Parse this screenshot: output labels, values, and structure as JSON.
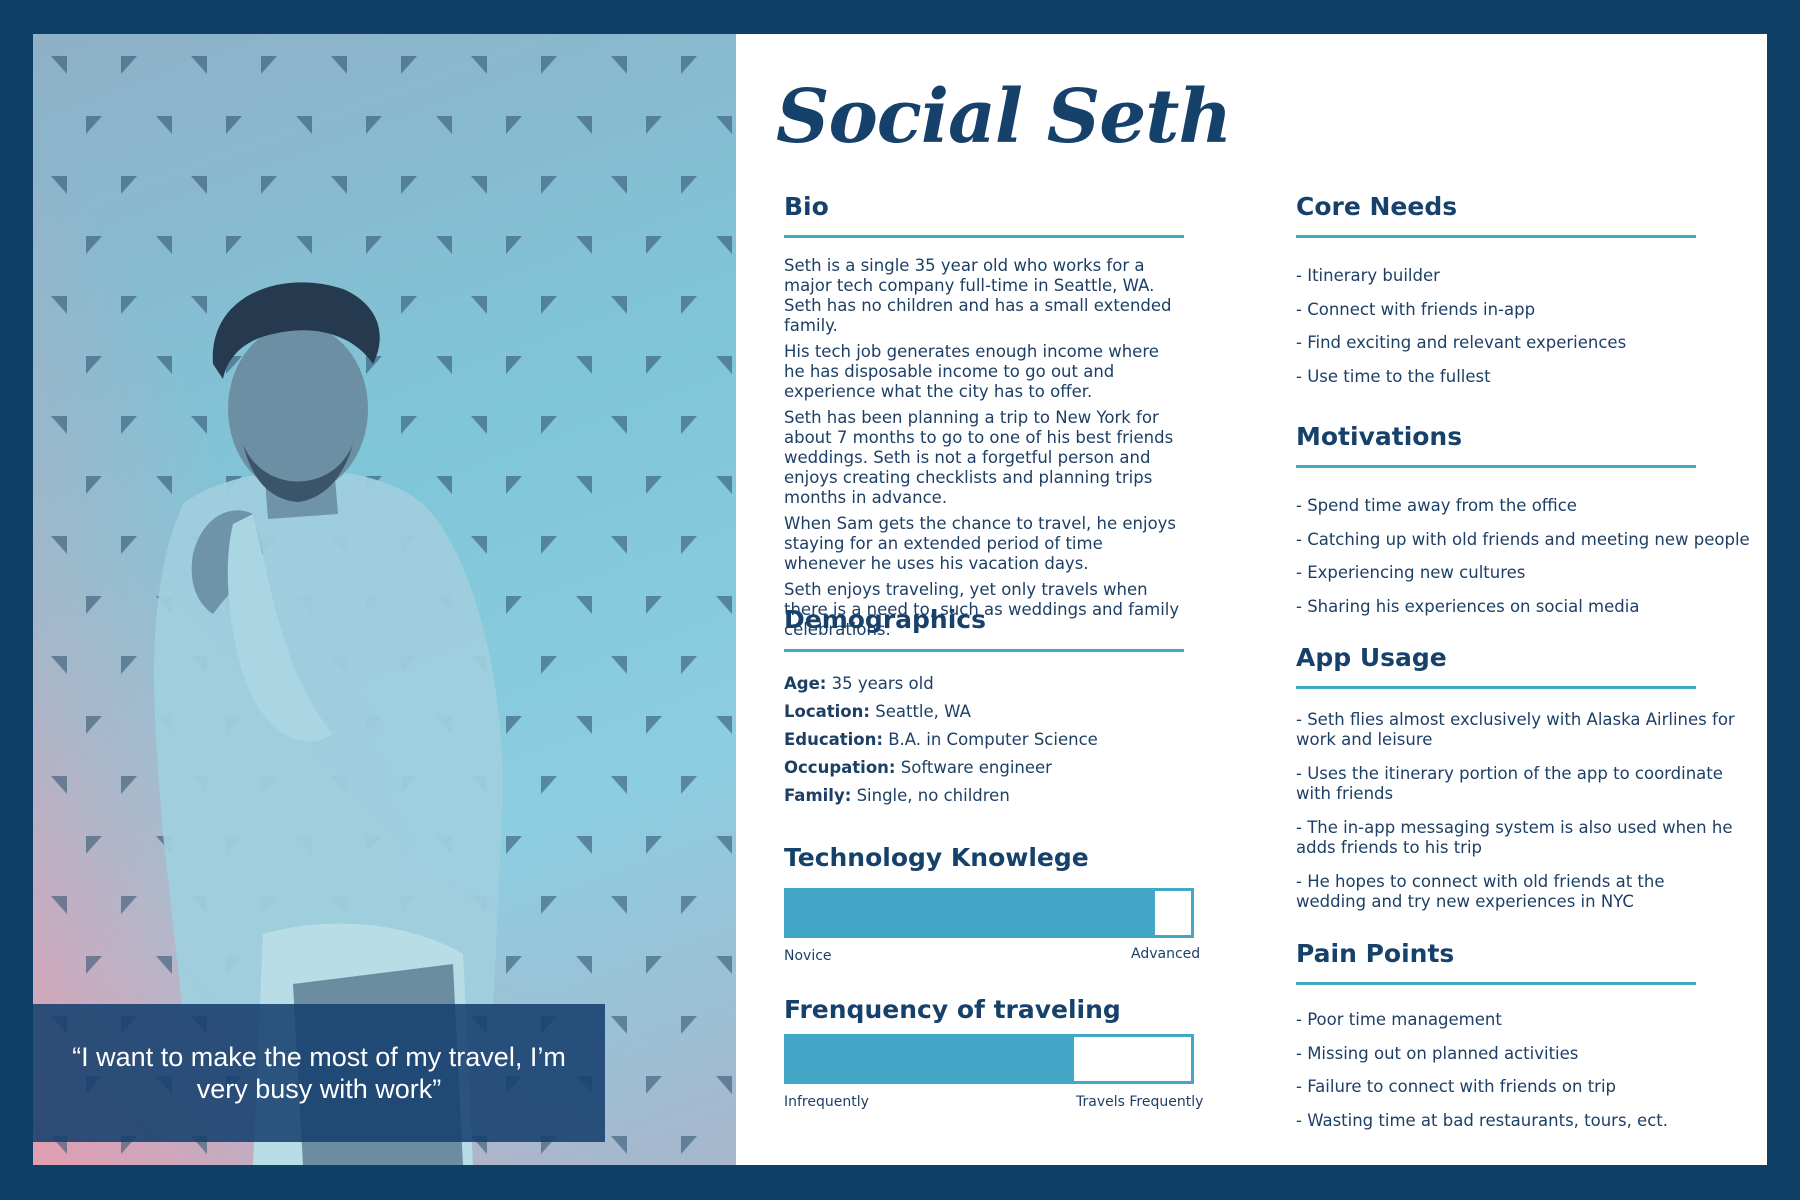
{
  "persona": {
    "name": "Social Seth"
  },
  "quote": "“I want to make the most of my travel, I’m very busy with work”",
  "bio": {
    "heading": "Bio",
    "paragraphs": [
      "Seth is a single 35 year old who works for a major tech company full-time in Seattle, WA. Seth has no children and has a small extended family.",
      "His tech job generates enough income where he has disposable income to go out and experience what the city has to offer.",
      "Seth has been planning a trip to New York for about 7 months to go to one of his best friends weddings. Seth is not a forgetful person and enjoys creating checklists and planning trips months in advance.",
      "When Sam gets the chance to travel, he enjoys staying for an extended period of time whenever he uses his vacation days.",
      "Seth enjoys traveling, yet only travels when there is a need to, such as weddings and family celebrations."
    ]
  },
  "demographics": {
    "heading": "Demographics",
    "items": [
      {
        "label": "Age:",
        "value": "35 years old"
      },
      {
        "label": "Location:",
        "value": "Seattle, WA"
      },
      {
        "label": "Education:",
        "value": "B.A. in Computer Science"
      },
      {
        "label": "Occupation:",
        "value": "Software engineer"
      },
      {
        "label": "Family:",
        "value": "Single, no children"
      }
    ]
  },
  "tech_knowledge": {
    "heading": "Technology Knowlege",
    "level": 0.91,
    "min_label": "Novice",
    "max_label": "Advanced"
  },
  "travel_frequency": {
    "heading": "Frenquency of traveling",
    "level": 0.71,
    "min_label": "Infrequently",
    "max_label": "Travels Frequently"
  },
  "core_needs": {
    "heading": "Core Needs",
    "items": [
      "- Itinerary builder",
      "- Connect with friends in-app",
      "- Find exciting and relevant experiences",
      "- Use time to the fullest"
    ]
  },
  "motivations": {
    "heading": "Motivations",
    "items": [
      "- Spend time away from the office",
      "- Catching up with old friends and meeting new people",
      "- Experiencing new cultures",
      "- Sharing his experiences on social media"
    ]
  },
  "app_usage": {
    "heading": "App Usage",
    "items": [
      "- Seth flies almost exclusively with Alaska Airlines for work and leisure",
      "- Uses the itinerary portion of the app to coordinate with friends",
      "- The in-app messaging system is also used when he adds friends to his trip",
      "- He hopes to connect with old friends at the wedding and try new experiences in NYC"
    ]
  },
  "pain_points": {
    "heading": "Pain Points",
    "items": [
      "- Poor time management",
      "- Missing out on planned activities",
      "- Failure to connect with friends on trip",
      "- Wasting time at bad restaurants, tours, ect."
    ]
  },
  "colors": {
    "frame": "#0e3f66",
    "accent": "#43a7c8",
    "text": "#1d3f66"
  }
}
